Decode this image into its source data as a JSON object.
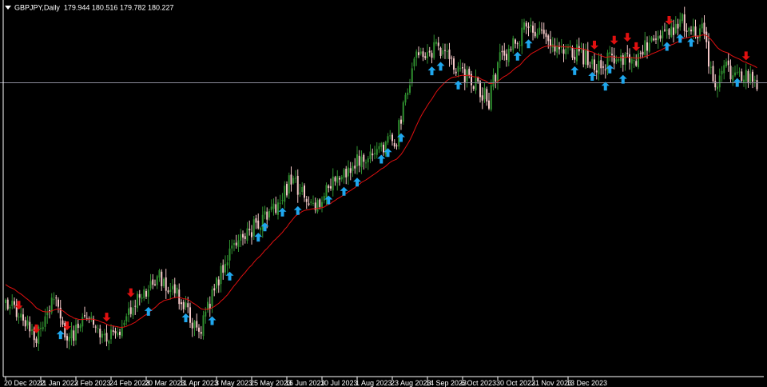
{
  "header": {
    "symbol": "GBPJPY,Daily",
    "ohlc": "179.944 180.516 179.782 180.227"
  },
  "colors": {
    "background": "#000000",
    "bull_candle": "#2f8f2f",
    "bear_candle": "#f4c7c7",
    "moving_average": "#e01010",
    "buy_arrow": "#1fa7ee",
    "sell_arrow": "#e01010",
    "price_line": "#8a8a9a",
    "axis": "#ffffff"
  },
  "chart_data": {
    "type": "candlestick",
    "x_tick_labels": [
      "20 Dec 2022",
      "11 Jan 2023",
      "2 Feb 2023",
      "24 Feb 2023",
      "20 Mar 2023",
      "11 Apr 2023",
      "3 May 2023",
      "25 May 2023",
      "16 Jun 2023",
      "10 Jul 2023",
      "1 Aug 2023",
      "23 Aug 2023",
      "14 Sep 2023",
      "6 Oct 2023",
      "30 Oct 2023",
      "21 Nov 2023",
      "13 Dec 2023"
    ],
    "ylim": [
      153.5,
      186.5
    ],
    "current_price": 180.227,
    "close_anchors": [
      [
        0,
        160.0
      ],
      [
        8,
        158.8
      ],
      [
        13,
        156.6
      ],
      [
        22,
        160.5
      ],
      [
        28,
        156.5
      ],
      [
        36,
        158.7
      ],
      [
        44,
        157.0
      ],
      [
        50,
        156.7
      ],
      [
        60,
        160.5
      ],
      [
        70,
        162.5
      ],
      [
        80,
        160.5
      ],
      [
        88,
        157.3
      ],
      [
        100,
        164.0
      ],
      [
        110,
        166.5
      ],
      [
        120,
        168.0
      ],
      [
        130,
        171.3
      ],
      [
        140,
        168.5
      ],
      [
        150,
        171.8
      ],
      [
        160,
        172.9
      ],
      [
        170,
        174.0
      ],
      [
        178,
        175.2
      ],
      [
        186,
        182.2
      ],
      [
        192,
        183.2
      ],
      [
        198,
        183.4
      ],
      [
        206,
        181.3
      ],
      [
        214,
        180.0
      ],
      [
        220,
        178.5
      ],
      [
        224,
        182.0
      ],
      [
        232,
        184.0
      ],
      [
        238,
        185.5
      ],
      [
        246,
        184.0
      ],
      [
        252,
        183.2
      ],
      [
        260,
        183.1
      ],
      [
        268,
        181.8
      ],
      [
        278,
        182.5
      ],
      [
        286,
        182.3
      ],
      [
        294,
        184.0
      ],
      [
        302,
        184.5
      ],
      [
        306,
        186.0
      ],
      [
        312,
        185.2
      ],
      [
        318,
        184.9
      ],
      [
        322,
        180.0
      ],
      [
        328,
        181.4
      ],
      [
        336,
        180.8
      ],
      [
        342,
        180.2
      ]
    ],
    "buy_signal_bars": [
      25,
      65,
      82,
      94,
      102,
      115,
      118,
      126,
      133,
      147,
      154,
      160,
      171,
      174,
      180,
      194,
      198,
      206,
      233,
      238,
      259,
      267,
      273,
      275,
      281,
      301,
      307,
      312,
      333
    ],
    "sell_signal_bars": [
      6,
      14,
      28,
      46,
      57,
      268,
      277,
      283,
      287,
      302,
      337,
      343
    ],
    "moving_average_note": ""
  }
}
